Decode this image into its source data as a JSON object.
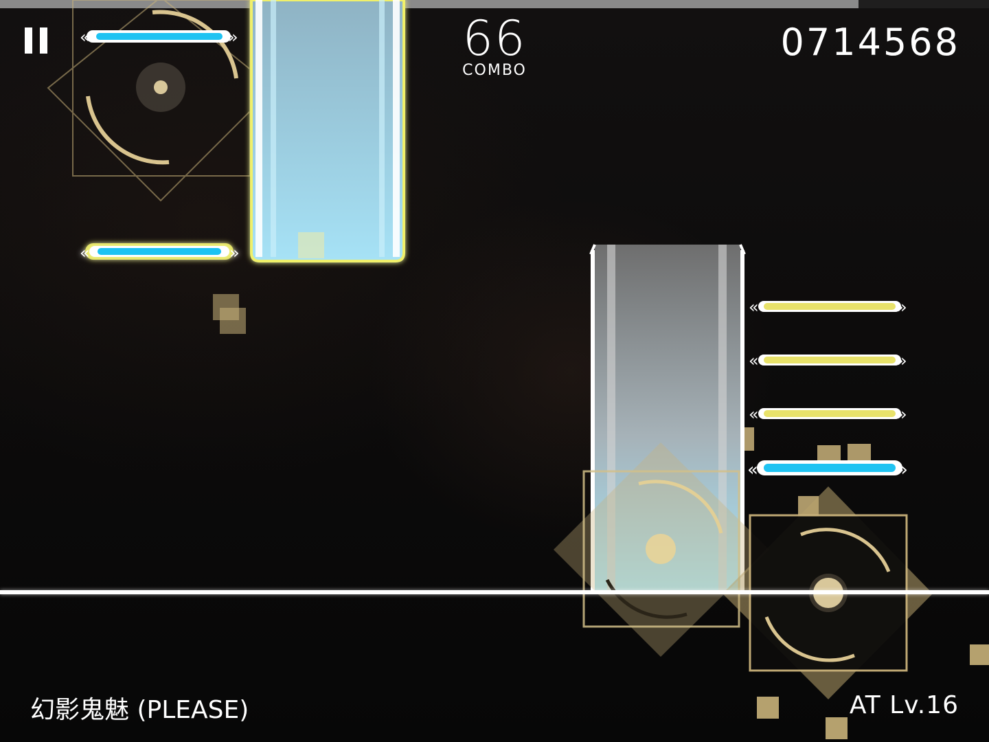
{
  "hud": {
    "combo": "66",
    "combo_label": "COMBO",
    "score": "0714568",
    "song_title": "幻影鬼魅 (PLEASE)",
    "difficulty": "AT  Lv.16",
    "progress": 0.868
  },
  "icons": {
    "pause": "pause-icon"
  },
  "colors": {
    "accent_blue": "#1fc3f2",
    "accent_yellow": "#e8e26a",
    "glow_yellow": "#f0f06a",
    "note_gold": "#c9b27a",
    "scanline": "#ffffff"
  }
}
